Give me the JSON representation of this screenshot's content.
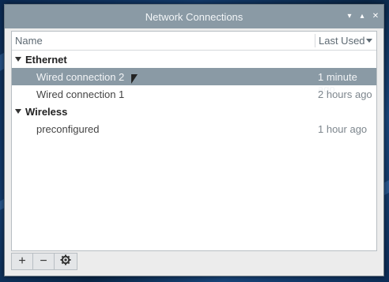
{
  "window": {
    "title": "Network Connections",
    "controls": {
      "minimize": "▾",
      "maximize": "▴",
      "close": "✕"
    }
  },
  "list": {
    "columns": {
      "name": "Name",
      "last_used": "Last Used"
    },
    "groups": [
      {
        "label": "Ethernet",
        "items": [
          {
            "name": "Wired connection 2",
            "last_used": "1 minute ago",
            "selected": true
          },
          {
            "name": "Wired connection 1",
            "last_used": "2 hours ago",
            "selected": false
          }
        ]
      },
      {
        "label": "Wireless",
        "items": [
          {
            "name": "preconfigured",
            "last_used": "1 hour ago",
            "selected": false
          }
        ]
      }
    ]
  },
  "toolbar": {
    "add": "+",
    "remove": "−"
  },
  "colors": {
    "titlebar": "#8a9aa5",
    "selection": "#8a9aa5",
    "desktop": "#0b2a52"
  }
}
